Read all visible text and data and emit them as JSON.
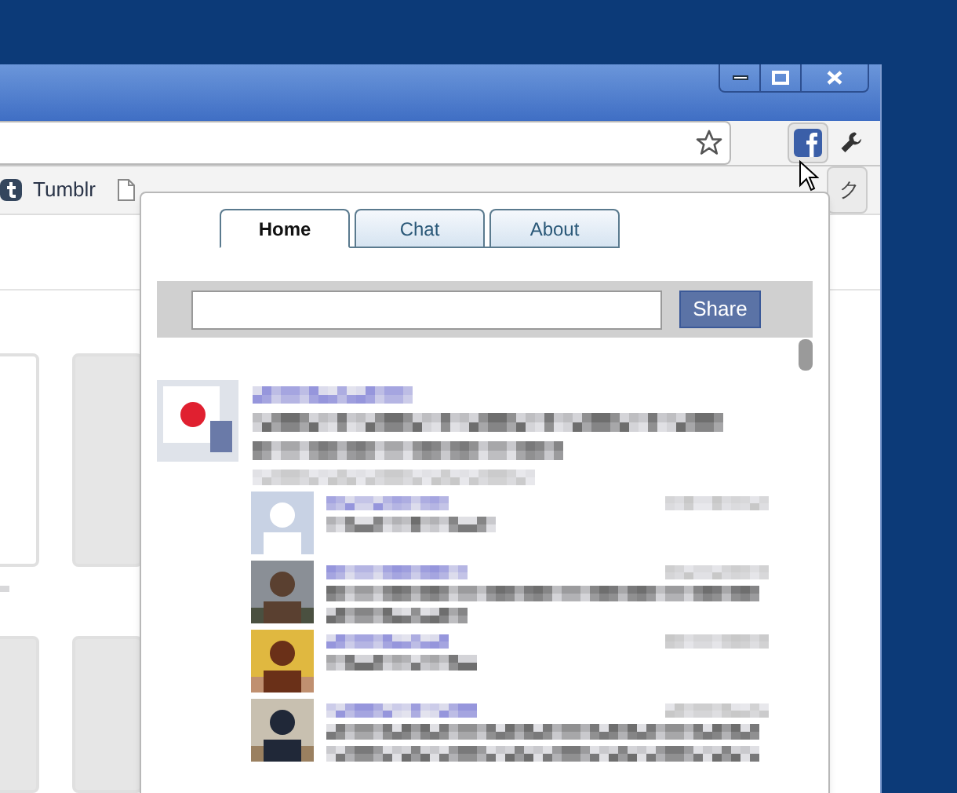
{
  "bookmarks_bar": {
    "items": [
      {
        "label": "Tumblr",
        "kind": "tumblr"
      },
      {
        "kind": "page"
      }
    ],
    "overflow_label": "ク"
  },
  "popup": {
    "tabs": [
      {
        "label": "Home",
        "selected": true
      },
      {
        "label": "Chat",
        "selected": false
      },
      {
        "label": "About",
        "selected": false
      }
    ],
    "share": {
      "button": "Share"
    }
  }
}
